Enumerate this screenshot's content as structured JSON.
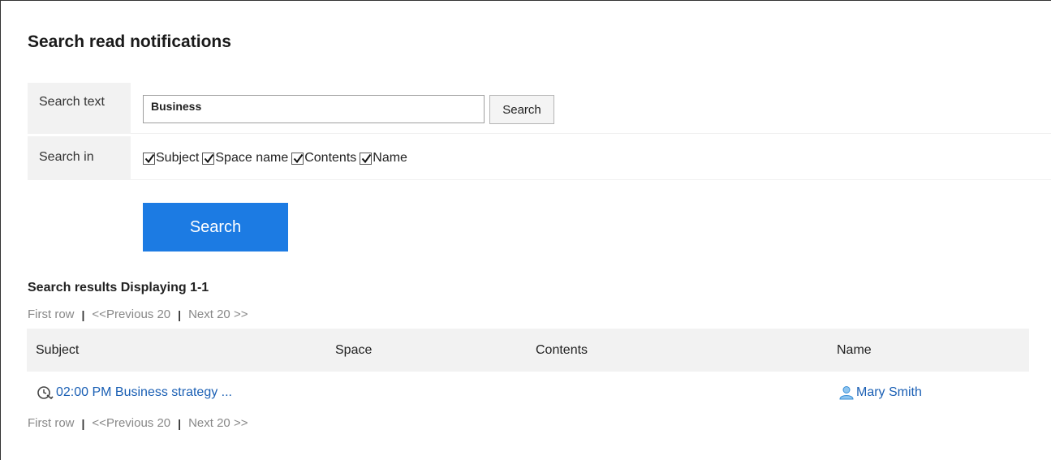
{
  "page": {
    "title": "Search read notifications"
  },
  "search_form": {
    "search_text_label": "Search text",
    "search_text_value": "Business",
    "inline_search_button": "Search",
    "search_in_label": "Search in",
    "options": [
      {
        "label": "Subject",
        "checked": true
      },
      {
        "label": "Space name",
        "checked": true
      },
      {
        "label": "Contents",
        "checked": true
      },
      {
        "label": "Name",
        "checked": true
      }
    ],
    "primary_search_button": "Search",
    "primary_color": "#1c7be3"
  },
  "results": {
    "heading": "Search results Displaying 1-1",
    "pager": {
      "first": "First row",
      "sep": "|",
      "prev": "<<Previous 20",
      "next": "Next 20 >>"
    },
    "columns": {
      "subject": "Subject",
      "space": "Space",
      "contents": "Contents",
      "name": "Name"
    },
    "rows": [
      {
        "subject": "02:00 PM Business strategy ...",
        "subject_icon": "schedule-icon",
        "space": "",
        "contents": "",
        "name": "Mary Smith",
        "name_icon": "user-icon"
      }
    ],
    "link_color": "#1a5fb4"
  }
}
